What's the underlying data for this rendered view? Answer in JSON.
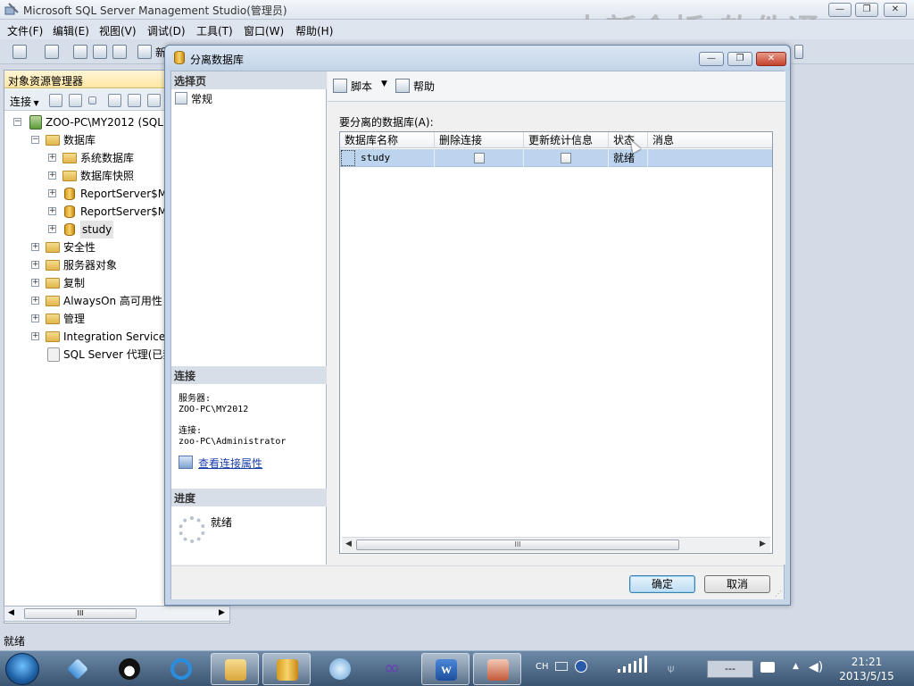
{
  "app": {
    "title": "Microsoft SQL Server Management Studio(管理员)",
    "watermark": "中新金桥 软件通",
    "window_controls": [
      "—",
      "❐",
      "✕"
    ]
  },
  "menu": [
    "文件(F)",
    "编辑(E)",
    "视图(V)",
    "调试(D)",
    "工具(T)",
    "窗口(W)",
    "帮助(H)"
  ],
  "toolbar": {
    "new_label": "新"
  },
  "object_explorer": {
    "title": "对象资源管理器",
    "connect_label": "连接",
    "tree": [
      {
        "label": "ZOO-PC\\MY2012 (SQL",
        "icon": "server-icon",
        "expander": "−"
      },
      {
        "label": "数据库",
        "icon": "folder-icon",
        "expander": "−"
      },
      {
        "label": "系统数据库",
        "icon": "folder-icon",
        "expander": "+"
      },
      {
        "label": "数据库快照",
        "icon": "folder-icon",
        "expander": "+"
      },
      {
        "label": "ReportServer$M",
        "icon": "database-icon",
        "expander": "+"
      },
      {
        "label": "ReportServer$M",
        "icon": "database-icon",
        "expander": "+"
      },
      {
        "label": "study",
        "icon": "database-icon",
        "expander": "+"
      },
      {
        "label": "安全性",
        "icon": "folder-icon",
        "expander": "+"
      },
      {
        "label": "服务器对象",
        "icon": "folder-icon",
        "expander": "+"
      },
      {
        "label": "复制",
        "icon": "folder-icon",
        "expander": "+"
      },
      {
        "label": "AlwaysOn 高可用性",
        "icon": "folder-icon",
        "expander": "+"
      },
      {
        "label": "管理",
        "icon": "folder-icon",
        "expander": "+"
      },
      {
        "label": "Integration Services",
        "icon": "folder-icon",
        "expander": "+"
      },
      {
        "label": "SQL Server 代理(已禁",
        "icon": "agent-icon",
        "expander": ""
      }
    ],
    "hscroll_thumb": "III"
  },
  "status": {
    "text": "就绪"
  },
  "dialog": {
    "title": "分离数据库",
    "left": {
      "select_page_header": "选择页",
      "pages": [
        "常规"
      ],
      "connection_header": "连接",
      "server_label": "服务器:",
      "server_value": "ZOO-PC\\MY2012",
      "connection_label": "连接:",
      "connection_value": "zoo-PC\\Administrator",
      "view_conn_props": "查看连接属性",
      "progress_header": "进度",
      "progress_status": "就绪"
    },
    "right": {
      "script_label": "脚本",
      "help_label": "帮助",
      "grid_label": "要分离的数据库(A):",
      "columns": [
        "数据库名称",
        "删除连接",
        "更新统计信息",
        "状态",
        "消息"
      ],
      "rows": [
        {
          "name": "study",
          "drop_connections": false,
          "update_statistics": false,
          "status": "就绪",
          "message": ""
        }
      ],
      "hscroll_thumb": "III"
    },
    "buttons": {
      "ok": "确定",
      "cancel": "取消"
    }
  },
  "taskbar": {
    "ime": "CH",
    "tray_box": "---",
    "time": "21:21",
    "date": "2013/5/15"
  }
}
